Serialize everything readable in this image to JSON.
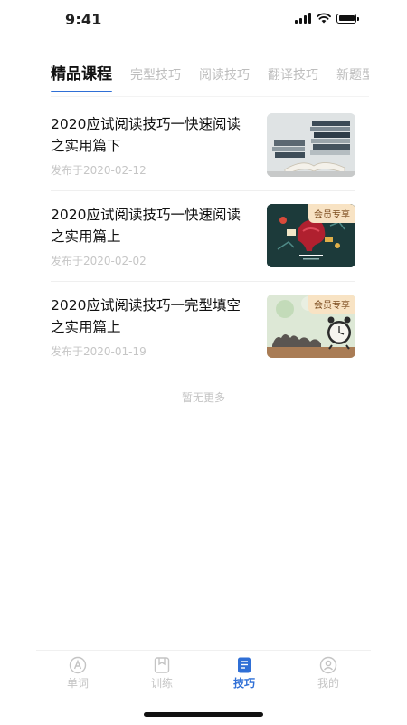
{
  "status_bar": {
    "time": "9:41"
  },
  "tabs": [
    {
      "label": "精品课程",
      "active": true
    },
    {
      "label": "完型技巧",
      "active": false
    },
    {
      "label": "阅读技巧",
      "active": false
    },
    {
      "label": "翻译技巧",
      "active": false
    },
    {
      "label": "新题型",
      "active": false
    }
  ],
  "courses": [
    {
      "title": "2020应试阅读技巧一快速阅读之实用篇下",
      "date": "发布于2020-02-12",
      "badge": "",
      "thumb_icon": "books-photo"
    },
    {
      "title": "2020应试阅读技巧一快速阅读之实用篇上",
      "date": "发布于2020-02-02",
      "badge": "会员专享",
      "thumb_icon": "brainstorm-illustration"
    },
    {
      "title": "2020应试阅读技巧一完型填空之实用篇上",
      "date": "发布于2020-01-19",
      "badge": "会员专享",
      "thumb_icon": "dream-clock-photo"
    }
  ],
  "list_footer": "暂无更多",
  "bottom_nav": [
    {
      "label": "单词",
      "icon": "letter-a-icon",
      "active": false
    },
    {
      "label": "训练",
      "icon": "bookmark-icon",
      "active": false
    },
    {
      "label": "技巧",
      "icon": "document-icon",
      "active": true
    },
    {
      "label": "我的",
      "icon": "profile-icon",
      "active": false
    }
  ],
  "colors": {
    "accent": "#2f6fd6",
    "badge_bg": "#f8e3c4",
    "badge_text": "#7a4a1c",
    "muted": "#c4c4c4"
  }
}
